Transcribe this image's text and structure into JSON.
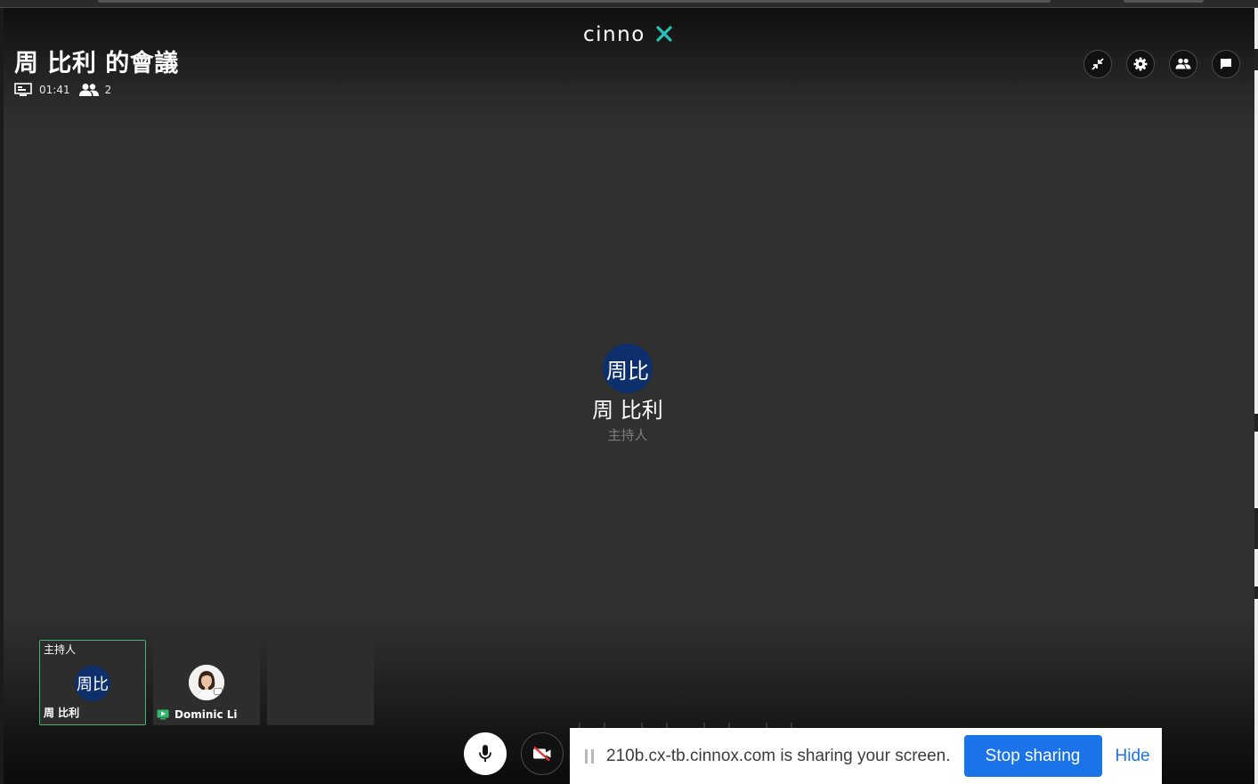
{
  "app": {
    "logo_text": "cinnox"
  },
  "header": {
    "meeting_title": "周 比利 的會議",
    "duration": "01:41",
    "participant_count": "2"
  },
  "top_controls": [
    {
      "name": "minimize",
      "icon": "collapse-arrows-icon"
    },
    {
      "name": "settings",
      "icon": "gear-icon"
    },
    {
      "name": "participants",
      "icon": "people-icon"
    },
    {
      "name": "chat",
      "icon": "chat-bubble-icon"
    }
  ],
  "main_speaker": {
    "avatar_initials": "周比",
    "name": "周 比利",
    "role": "主持人"
  },
  "tiles": [
    {
      "tag": "主持人",
      "initials": "周比",
      "name": "周 比利",
      "active": true
    },
    {
      "tag": "",
      "initials": "",
      "name": "Dominic Li",
      "active": false,
      "sharing_icon": "screen-share-icon"
    },
    {
      "tag": "",
      "initials": "",
      "name": "",
      "active": false
    }
  ],
  "bottom_controls": {
    "mic": {
      "icon": "microphone-icon",
      "state": "on"
    },
    "camera": {
      "icon": "camera-off-icon",
      "state": "off"
    }
  },
  "share_bar": {
    "message": "210b.cx-tb.cinnox.com is sharing your screen.",
    "stop_label": "Stop sharing",
    "hide_label": "Hide"
  },
  "colors": {
    "active_border": "#3fb36f",
    "avatar_bg": "#0d2f6b",
    "stop_button": "#1a73e8",
    "logo_accent": "#28c3b8"
  }
}
